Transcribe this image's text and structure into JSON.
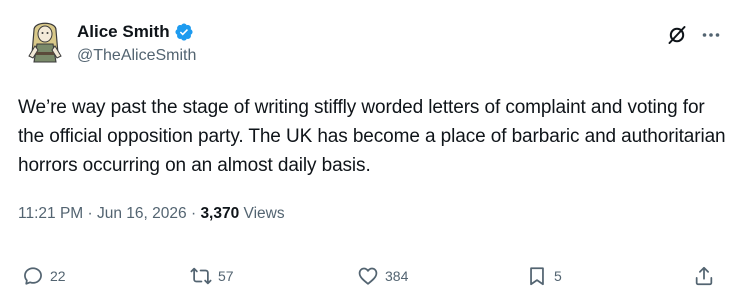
{
  "author": {
    "display_name": "Alice Smith",
    "handle": "@TheAliceSmith",
    "verified": true
  },
  "post": {
    "text": "We’re way past the stage of writing stiffly worded letters of complaint and voting for the official opposition party. The UK has become a place of barbaric and authoritarian horrors occurring on an almost daily basis."
  },
  "meta": {
    "time": "11:21 PM",
    "sep1": "·",
    "date": "Jun 16, 2026",
    "sep2": "·",
    "views_count": "3,370",
    "views_label": "Views"
  },
  "actions": {
    "replies": "22",
    "reposts": "57",
    "likes": "384",
    "bookmarks": "5"
  },
  "icons": {
    "verified": "verified-badge-icon",
    "grok": "grok-icon",
    "more": "more-options-icon",
    "reply": "reply-icon",
    "repost": "repost-icon",
    "like": "like-icon",
    "bookmark": "bookmark-icon",
    "share": "share-icon"
  },
  "colors": {
    "text_primary": "#0f1419",
    "text_secondary": "#536471",
    "verified_blue": "#1d9bf0"
  }
}
